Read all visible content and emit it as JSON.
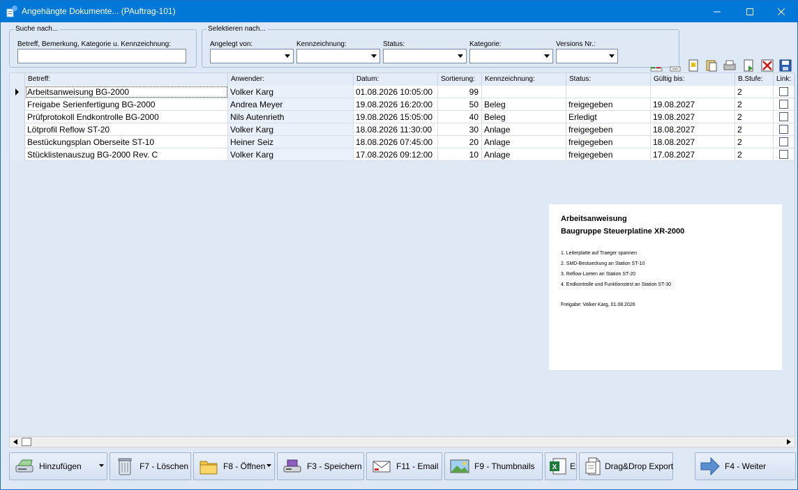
{
  "window": {
    "title": "Angehängte Dokumente... (PAuftrag-101)"
  },
  "search": {
    "legend": "Suche nach...",
    "label": "Betreff, Bemerkung, Kategorie u. Kennzeichnung:",
    "value": ""
  },
  "filter": {
    "legend": "Selektieren nach...",
    "angelegt_label": "Angelegt von:",
    "kennzeichnung_label": "Kennzeichnung:",
    "status_label": "Status:",
    "kategorie_label": "Kategorie:",
    "version_label": "Versions Nr.:"
  },
  "grid": {
    "columns": [
      "Betreff:",
      "Anwender:",
      "Datum:",
      "Sortierung:",
      "Kennzeichnung:",
      "Status:",
      "Gültig bis:",
      "B.Stufe:",
      "Link:"
    ],
    "rows": [
      {
        "betreff": "Arbeitsanweisung BG-2000",
        "anwender": "Volker Karg",
        "datum": "01.08.2026 10:05:00",
        "sort": "99",
        "kennz": "",
        "status": "",
        "gueltig": "",
        "stufe": "2",
        "link": false
      },
      {
        "betreff": "Freigabe Serienfertigung BG-2000",
        "anwender": "Andrea Meyer",
        "datum": "19.08.2026 16:20:00",
        "sort": "50",
        "kennz": "Beleg",
        "status": "freigegeben",
        "gueltig": "19.08.2027",
        "stufe": "2",
        "link": false
      },
      {
        "betreff": "Prüfprotokoll Endkontrolle BG-2000",
        "anwender": "Nils Autenrieth",
        "datum": "19.08.2026 15:05:00",
        "sort": "40",
        "kennz": "Beleg",
        "status": "Erledigt",
        "gueltig": "19.08.2027",
        "stufe": "2",
        "link": false
      },
      {
        "betreff": "Lötprofil Reflow ST-20",
        "anwender": "Volker Karg",
        "datum": "18.08.2026 11:30:00",
        "sort": "30",
        "kennz": "Anlage",
        "status": "freigegeben",
        "gueltig": "18.08.2027",
        "stufe": "2",
        "link": false
      },
      {
        "betreff": "Bestückungsplan Oberseite ST-10",
        "anwender": "Heiner Seiz",
        "datum": "18.08.2026 07:45:00",
        "sort": "20",
        "kennz": "Anlage",
        "status": "freigegeben",
        "gueltig": "18.08.2027",
        "stufe": "2",
        "link": false
      },
      {
        "betreff": "Stücklistenauszug BG-2000 Rev. C",
        "anwender": "Volker Karg",
        "datum": "17.08.2026 09:12:00",
        "sort": "10",
        "kennz": "Anlage",
        "status": "freigegeben",
        "gueltig": "17.08.2027",
        "stufe": "2",
        "link": false
      }
    ]
  },
  "preview": {
    "title1": "Arbeitsanweisung",
    "title2": "Baugruppe Steuerplatine XR-2000",
    "lines": [
      "1. Leiterplatte auf Traeger spannen",
      "2. SMD-Bestueckung an Station ST-10",
      "3. Reflow-Loeten an Station ST-20",
      "4. Endkontrolle und Funktionstest an Station ST-30"
    ],
    "footer": "Freigabe: Volker Karg, 01.08.2026"
  },
  "buttons": {
    "hinzufuegen": "Hinzufügen",
    "loeschen": "F7 - Löschen",
    "oeffnen": "F8 - Öffnen",
    "speichern": "F3 - Speichern",
    "email": "F11 - Email",
    "thumbnails": "F9 - Thumbnails",
    "excel": "Ex",
    "dragdrop": "Drag&Drop Export",
    "weiter": "F4 - Weiter"
  }
}
